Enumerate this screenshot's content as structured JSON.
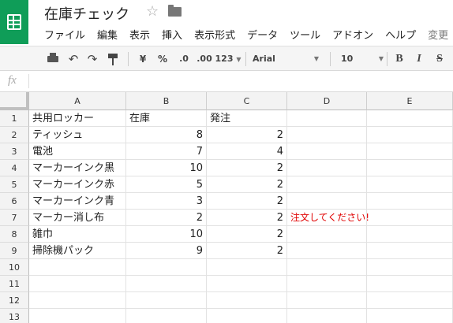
{
  "document": {
    "title": "在庫チェック"
  },
  "menu": [
    "ファイル",
    "編集",
    "表示",
    "挿入",
    "表示形式",
    "データ",
    "ツール",
    "アドオン",
    "ヘルプ",
    "変更"
  ],
  "toolbar": {
    "currency": "¥",
    "percent": "%",
    "decrease_decimal": ".0",
    "increase_decimal": ".00",
    "more_formats": "123",
    "font": "Arial",
    "font_size": "10",
    "bold": "B",
    "italic": "I",
    "strikethrough": "S"
  },
  "formula_bar": {
    "fx_label": "fx",
    "value": ""
  },
  "columns": [
    "A",
    "B",
    "C",
    "D",
    "E"
  ],
  "rows": [
    {
      "num": "1",
      "a": "共用ロッカー",
      "b": "在庫",
      "c": "発注",
      "d": ""
    },
    {
      "num": "2",
      "a": "ティッシュ",
      "b": "8",
      "c": "2",
      "d": ""
    },
    {
      "num": "3",
      "a": "電池",
      "b": "7",
      "c": "4",
      "d": ""
    },
    {
      "num": "4",
      "a": "マーカーインク黒",
      "b": "10",
      "c": "2",
      "d": ""
    },
    {
      "num": "5",
      "a": "マーカーインク赤",
      "b": "5",
      "c": "2",
      "d": ""
    },
    {
      "num": "6",
      "a": "マーカーインク青",
      "b": "3",
      "c": "2",
      "d": ""
    },
    {
      "num": "7",
      "a": "マーカー消し布",
      "b": "2",
      "c": "2",
      "d": "注文してください!"
    },
    {
      "num": "8",
      "a": "雑巾",
      "b": "10",
      "c": "2",
      "d": ""
    },
    {
      "num": "9",
      "a": "掃除機パック",
      "b": "9",
      "c": "2",
      "d": ""
    },
    {
      "num": "10",
      "a": "",
      "b": "",
      "c": "",
      "d": ""
    },
    {
      "num": "11",
      "a": "",
      "b": "",
      "c": "",
      "d": ""
    },
    {
      "num": "12",
      "a": "",
      "b": "",
      "c": "",
      "d": ""
    },
    {
      "num": "13",
      "a": "",
      "b": "",
      "c": "",
      "d": ""
    }
  ],
  "colors": {
    "brand": "#0f9d58",
    "alert_text": "#e00000"
  }
}
